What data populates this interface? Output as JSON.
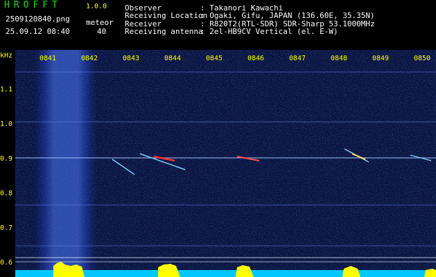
{
  "header": {
    "app_title": "HROFFT",
    "app_version": "1.0.0",
    "filename": "2509120840.png",
    "datetime": "25.09.12 08:40",
    "meteor_label": "meteor",
    "meteor_count": "40",
    "info": [
      {
        "label": "Observer",
        "value": ": Takanori Kawachi"
      },
      {
        "label": "Receiving Location",
        "value": ": Ogaki, Gifu, JAPAN (136.60E, 35.35N)"
      },
      {
        "label": "Receiver",
        "value": ": R820T2(RTL-SDR) SDR-Sharp 53.1000MHz"
      },
      {
        "label": "Receiving antenna",
        "value": ": 2el-HB9CV Vertical (el. E-W)"
      }
    ]
  },
  "spectrogram": {
    "unit_label": "kHz",
    "time_ticks": [
      "0841",
      "0842",
      "0843",
      "0844",
      "0845",
      "0846",
      "0847",
      "0848",
      "0849",
      "0850"
    ],
    "freq_ticks": [
      "1.1",
      "1.0",
      "0.9",
      "0.8",
      "0.7",
      "0.6"
    ],
    "colors": {
      "background": "#0a1440",
      "signal": "#ffff00",
      "noise_bar": "#00c8ff"
    }
  }
}
